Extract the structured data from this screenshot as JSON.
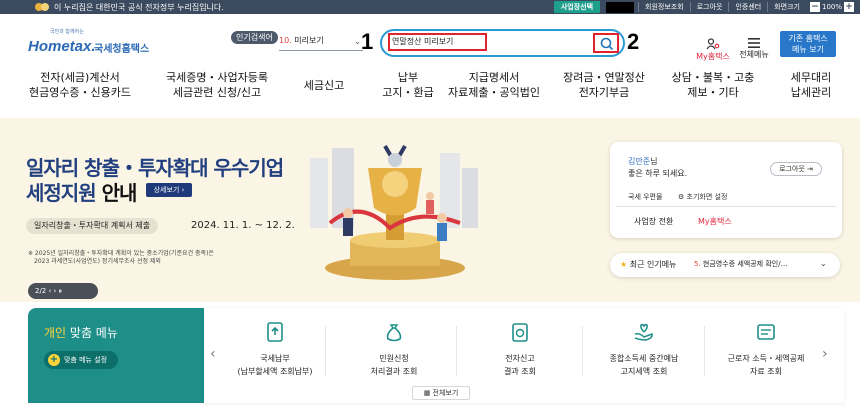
{
  "topbar": {
    "gov_notice": "이 누리집은 대한민국 공식 전자정부 누리집입니다.",
    "biz_select": "사업장선택",
    "links": [
      "회원정보조회",
      "로그아웃",
      "인증센터",
      "화면크기"
    ],
    "zoom": "100%",
    "zoom_minus": "−",
    "zoom_plus": "+"
  },
  "header": {
    "logo_tag": "국민과 함께하는",
    "logo_main": "Hometax.",
    "logo_sub": "국세청홈택스",
    "popular_tag": "인기검색어",
    "popular_num": "10.",
    "popular_text": "미리보기",
    "search_value": "연말정산 미리보기",
    "callout_1": "1",
    "callout_2": "2",
    "my_home": "My홈택스",
    "all_menu": "전체메뉴",
    "old_home_line1": "기존 홈택스",
    "old_home_line2": "메뉴 보기"
  },
  "gnb": [
    {
      "l1": "전자(세금)계산서",
      "l2": "현금영수증・신용카드"
    },
    {
      "l1": "국세증명・사업자등록",
      "l2": "세금관련 신청/신고"
    },
    {
      "l1": "세금신고",
      "l2": ""
    },
    {
      "l1": "납부",
      "l2": "고지・환급"
    },
    {
      "l1": "지급명세서",
      "l2": "자료제출・공익법인"
    },
    {
      "l1": "장려금・연말정산",
      "l2": "전자기부금"
    },
    {
      "l1": "상담・불복・고충",
      "l2": "제보・기타"
    },
    {
      "l1": "세무대리",
      "l2": "납세관리"
    }
  ],
  "banner": {
    "title_line1": "일자리 창출・투자확대 우수기업",
    "title_line2_hl": "세정지원",
    "title_line2_plain": " 안내",
    "detail_button": "상세보기 ›",
    "tag": "일자리창출・투자확대 계획서 제출",
    "date": "2024. 11. 1. ~ 12. 2.",
    "note_line1": "※ 2025년 일자리창출・투자확대 계획이 있는 중소기업(기준요건 충족)은",
    "note_line2": "2023 과세연도(사업연도) 정기세무조사 선정 제외",
    "pager": "2/2   ‹   ›   ⏸"
  },
  "user": {
    "name": "김만준",
    "name_suffix": "님",
    "greeting": "좋은 하루 되세요.",
    "logout": "로그아웃 ⇥",
    "tax_office": "국세 우편물",
    "reset": "초기화면 설정",
    "switch": "사업장 전환",
    "my_home": "My홈택스"
  },
  "popular_panel": {
    "label": "최근 인기메뉴",
    "num": "5.",
    "text": "현금영수증 세액공제 확인/…"
  },
  "personal_menu": {
    "title_hl": "개인",
    "title_plain": " 맞춤 메뉴",
    "setting": "맞춤 메뉴 설정",
    "plus": "+",
    "all_view": "전체보기",
    "services": [
      {
        "l1": "국세납부",
        "l2": "(납부할세액 조회납부)"
      },
      {
        "l1": "민원신청",
        "l2": "처리결과 조회"
      },
      {
        "l1": "전자신고",
        "l2": "결과 조회"
      },
      {
        "l1": "종합소득세 중간예납",
        "l2": "고지세액 조회"
      },
      {
        "l1": "근로자 소득・세액공제",
        "l2": "자료 조회"
      }
    ]
  }
}
